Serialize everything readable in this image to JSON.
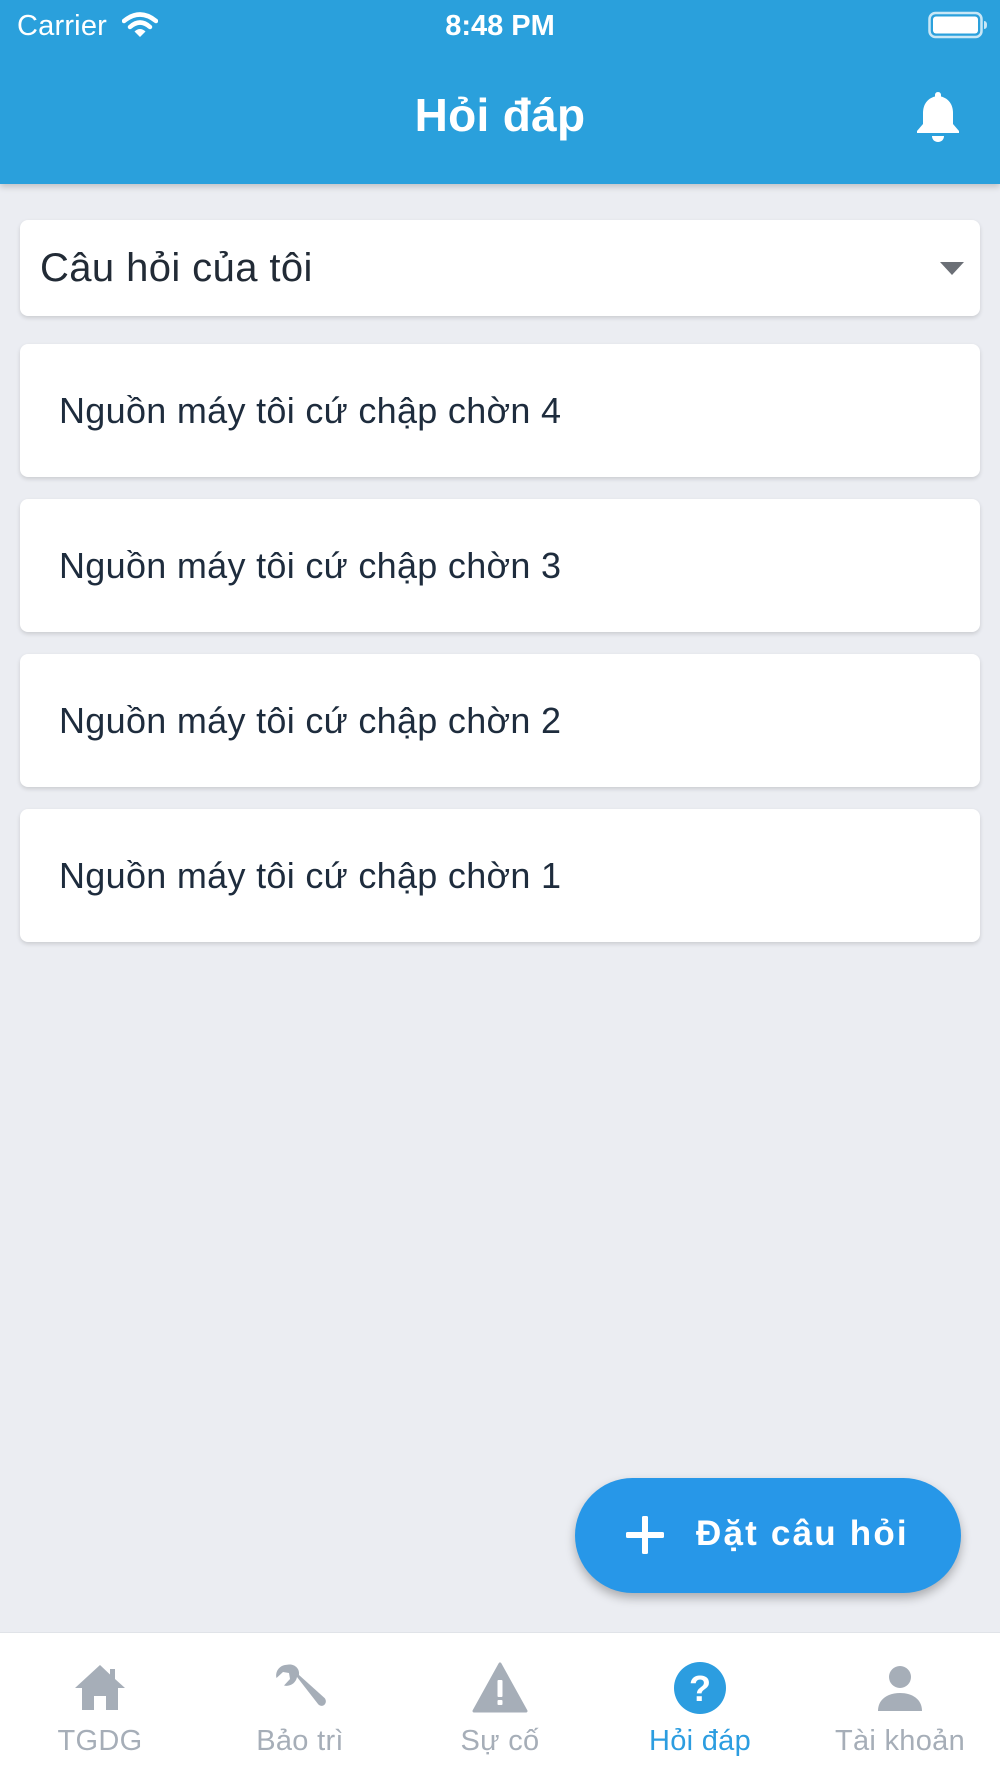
{
  "status_bar": {
    "carrier": "Carrier",
    "time": "8:48 PM"
  },
  "header": {
    "title": "Hỏi đáp"
  },
  "filter": {
    "selected": "Câu hỏi của tôi"
  },
  "questions": [
    {
      "title": "Nguồn máy tôi cứ chập chờn 4"
    },
    {
      "title": "Nguồn máy tôi cứ chập chờn 3"
    },
    {
      "title": "Nguồn máy tôi cứ chập chờn 2"
    },
    {
      "title": "Nguồn máy tôi cứ chập chờn 1"
    }
  ],
  "fab": {
    "label": "Đặt câu hỏi",
    "icon": "plus-icon"
  },
  "tabs": [
    {
      "label": "TGDG",
      "icon": "home-icon",
      "active": false
    },
    {
      "label": "Bảo trì",
      "icon": "wrench-icon",
      "active": false
    },
    {
      "label": "Sự cố",
      "icon": "warning-icon",
      "active": false
    },
    {
      "label": "Hỏi đáp",
      "icon": "question-circle-icon",
      "active": true
    },
    {
      "label": "Tài khoản",
      "icon": "user-icon",
      "active": false
    }
  ],
  "colors": {
    "header": "#2aa0dc",
    "accent": "#2797e8",
    "tab_active": "#2c9de0",
    "tab_inactive": "#a6aeb8",
    "background": "#ebedf2"
  }
}
